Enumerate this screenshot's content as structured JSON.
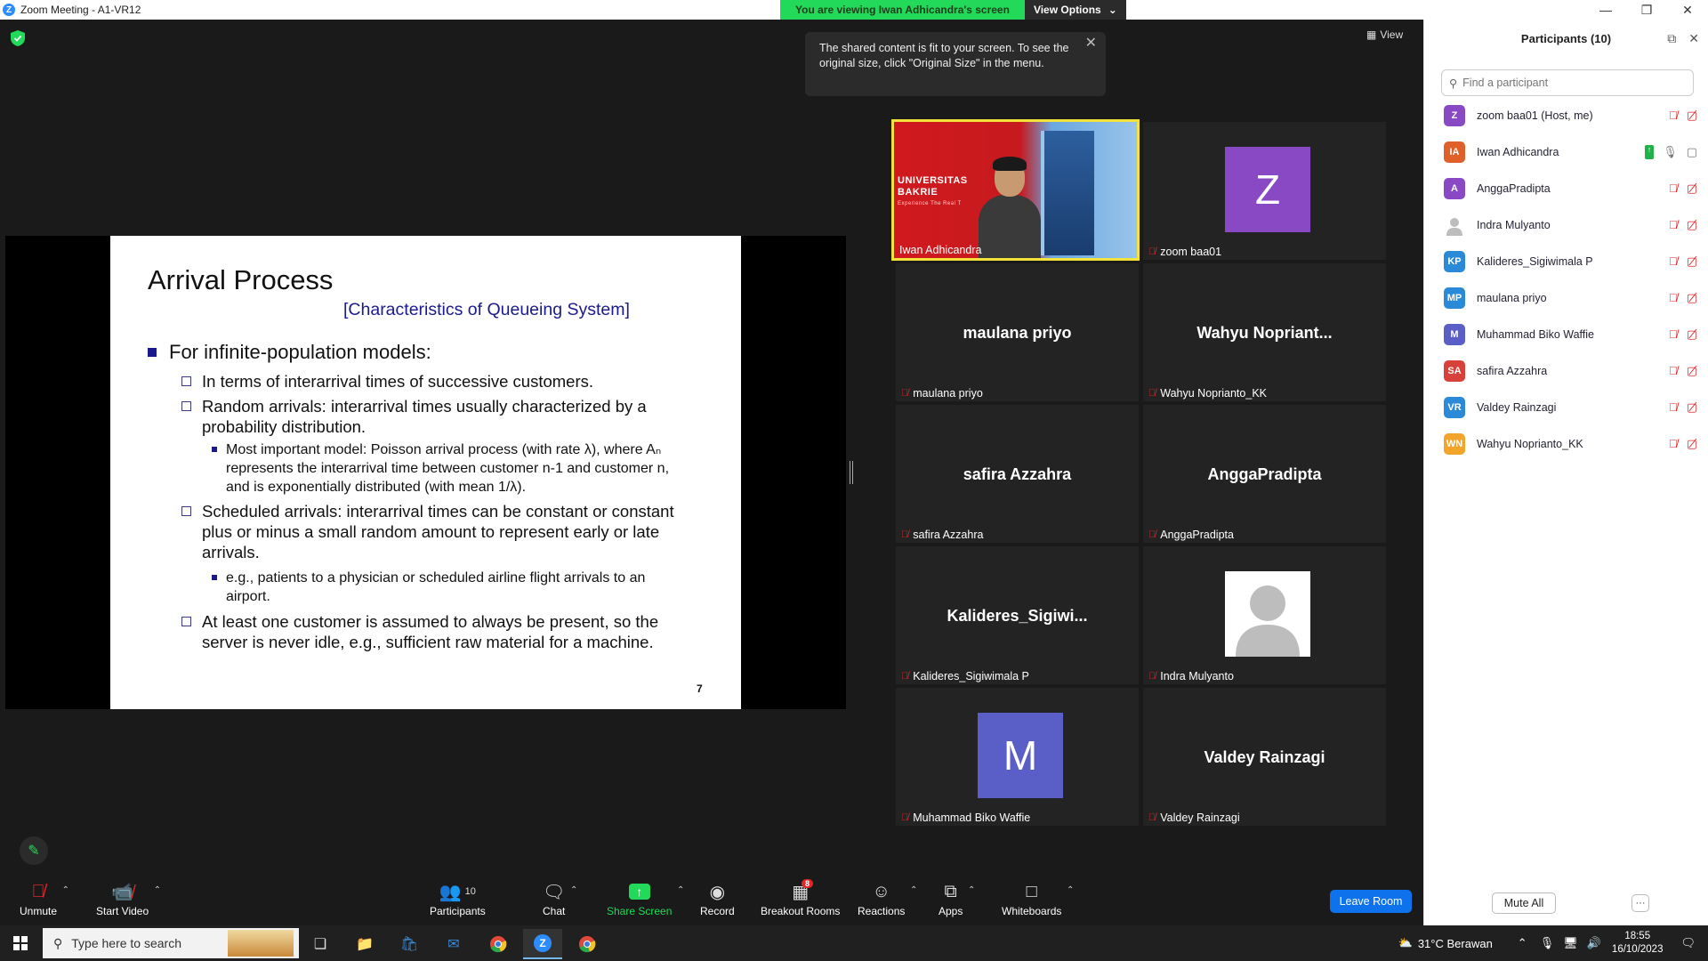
{
  "window": {
    "title": "Zoom Meeting - A1-VR12"
  },
  "banner": {
    "viewing": "You are viewing Iwan Adhicandra's screen",
    "options": "View Options"
  },
  "view_label": "View",
  "tooltip": "The shared content is fit to your screen. To see the original size, click \"Original Size\" in the menu.",
  "slide": {
    "title": "Arrival Process",
    "subtitle": "[Characteristics of Queueing System]",
    "b1": "For infinite-population models:",
    "b1_1": "In terms of interarrival times of successive customers.",
    "b1_2": "Random arrivals: interarrival times usually characterized by a probability distribution.",
    "b1_2_1": "Most important model: Poisson arrival process (with rate λ), where Aₙ represents the interarrival time between customer n-1 and customer n, and is exponentially distributed (with mean 1/λ).",
    "b1_3": "Scheduled arrivals: interarrival times can be constant or constant plus or minus a small random amount to represent early or late arrivals.",
    "b1_3_1": "e.g., patients to a physician or scheduled airline flight arrivals to an airport.",
    "b1_4": "At least one customer is assumed to always be present, so the server is never idle, e.g., sufficient raw material for a machine.",
    "page": "7"
  },
  "gallery": [
    {
      "name": "Iwan Adhicandra",
      "type": "video",
      "overlay1": "UNIVERSITAS",
      "overlay2": "BAKRIE",
      "overlay3": "Experience The Real T"
    },
    {
      "name": "zoom baa01",
      "type": "avatar",
      "letter": "Z",
      "color": "#8a49c4"
    },
    {
      "name": "maulana priyo",
      "type": "text",
      "display": "maulana priyo"
    },
    {
      "name": "Wahyu Noprianto_KK",
      "type": "text",
      "display": "Wahyu  Nopriant..."
    },
    {
      "name": "safira Azzahra",
      "type": "text",
      "display": "safira Azzahra"
    },
    {
      "name": "AnggaPradipta",
      "type": "text",
      "display": "AnggaPradipta"
    },
    {
      "name": "Kalideres_Sigiwimala P",
      "type": "text",
      "display": "Kalideres_Sigiwi..."
    },
    {
      "name": "Indra Mulyanto",
      "type": "photo"
    },
    {
      "name": "Muhammad Biko Waffie",
      "type": "avatar",
      "letter": "M",
      "color": "#5a5fc8"
    },
    {
      "name": "Valdey Rainzagi",
      "type": "text",
      "display": "Valdey Rainzagi"
    }
  ],
  "participants": {
    "title": "Participants (10)",
    "search_placeholder": "Find a participant",
    "list": [
      {
        "initials": "Z",
        "name": "zoom baa01 (Host, me)",
        "color": "#8a49c4"
      },
      {
        "initials": "IA",
        "name": "Iwan Adhicandra",
        "color": "#e0602a",
        "sharing": true
      },
      {
        "initials": "A",
        "name": "AnggaPradipta",
        "color": "#8a49c4"
      },
      {
        "initials": "",
        "name": "Indra Mulyanto",
        "color": "#bcbcbc"
      },
      {
        "initials": "KP",
        "name": "Kalideres_Sigiwimala P",
        "color": "#2a8ad8"
      },
      {
        "initials": "MP",
        "name": "maulana priyo",
        "color": "#2a8ad8"
      },
      {
        "initials": "M",
        "name": "Muhammad Biko Waffie",
        "color": "#5a5fc8"
      },
      {
        "initials": "SA",
        "name": "safira Azzahra",
        "color": "#d8403a"
      },
      {
        "initials": "VR",
        "name": "Valdey Rainzagi",
        "color": "#2a8ad8"
      },
      {
        "initials": "WN",
        "name": "Wahyu Noprianto_KK",
        "color": "#f2a52a"
      }
    ],
    "mute_all": "Mute All",
    "more": "···"
  },
  "toolbar": {
    "unmute": "Unmute",
    "start_video": "Start Video",
    "participants": "Participants",
    "participants_count": "10",
    "chat": "Chat",
    "share_screen": "Share Screen",
    "record": "Record",
    "breakout": "Breakout Rooms",
    "breakout_badge": "8",
    "reactions": "Reactions",
    "apps": "Apps",
    "whiteboards": "Whiteboards",
    "leave": "Leave Room"
  },
  "taskbar": {
    "search": "Type here to search",
    "weather": "31°C  Berawan",
    "time": "18:55",
    "date": "16/10/2023"
  }
}
